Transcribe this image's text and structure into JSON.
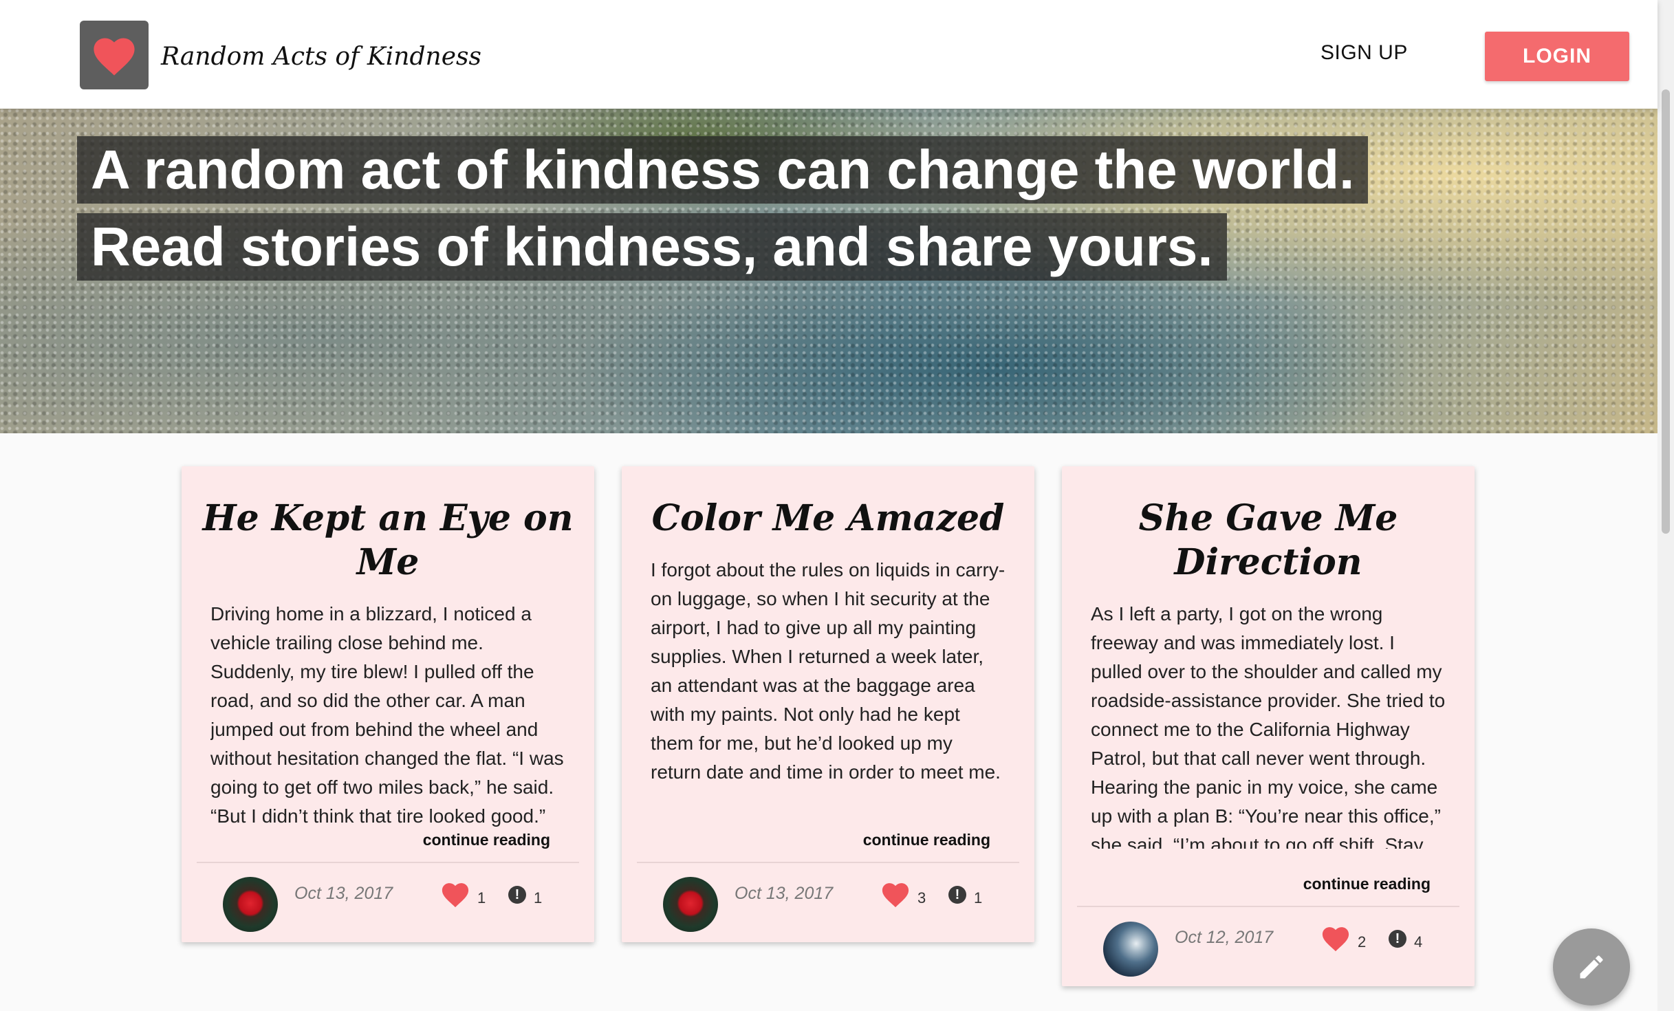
{
  "header": {
    "brand": "Random Acts of Kindness",
    "signup_label": "SIGN UP",
    "login_label": "LOGIN",
    "logo_icon": "heart-icon"
  },
  "hero": {
    "line1": "A random act of kindness can change the world.",
    "line2": "Read stories of kindness, and share yours."
  },
  "stories": [
    {
      "title": "He Kept an Eye on Me",
      "excerpt": "Driving home in a blizzard, I noticed a vehicle trailing close behind me. Suddenly, my tire blew! I pulled off the road, and so did the other car. A man jumped out from behind the wheel and without hesitation changed the flat. “I was going to get off two miles back,” he said. “But I didn’t think that tire looked good.”",
      "continue": "continue reading",
      "date": "Oct 13, 2017",
      "likes": "1",
      "flags": "1"
    },
    {
      "title": "Color Me Amazed",
      "excerpt": "I forgot about the rules on liquids in carry-on luggage, so when I hit security at the airport, I had to give up all my painting supplies. When I returned a week later, an attendant was at the baggage area with my paints. Not only had he kept them for me, but he’d looked up my return date and time in order to meet me.",
      "continue": "continue reading",
      "date": "Oct 13, 2017",
      "likes": "3",
      "flags": "1"
    },
    {
      "title": "She Gave Me Direction",
      "excerpt": "As I left a party, I got on the wrong freeway and was immediately lost. I pulled over to the shoulder and called my roadside-assistance provider. She tried to connect me to the California Highway Patrol, but that call never went through. Hearing the panic in my voice, she came up with a plan B: “You’re near this office,” she said. “I’m about to go off shift. Stay put and I’ll find you.”",
      "continue": "continue reading",
      "date": "Oct 12, 2017",
      "likes": "2",
      "flags": "4"
    }
  ],
  "colors": {
    "accent": "#f46b6e",
    "card_bg": "#fde9ea",
    "heart": "#f0545a"
  },
  "fab_icon": "pencil-icon"
}
